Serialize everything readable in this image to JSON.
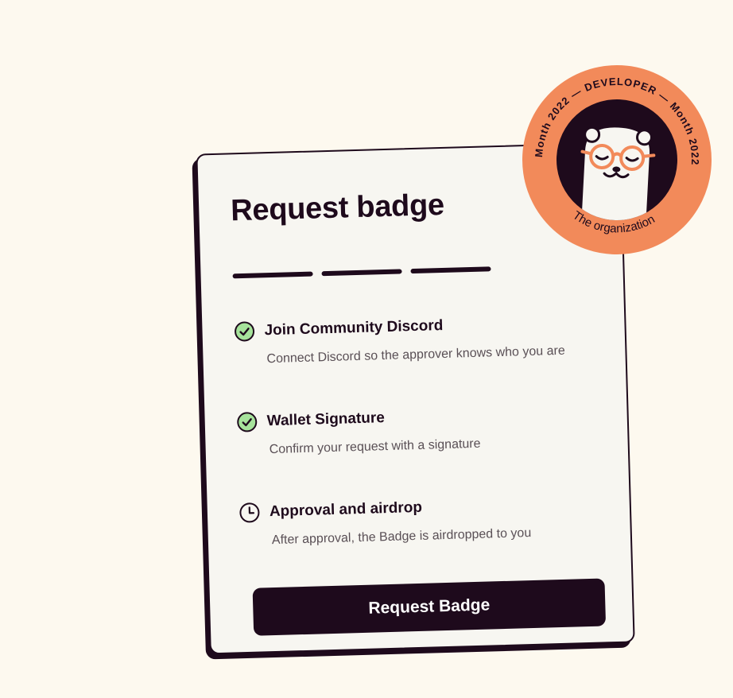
{
  "card": {
    "title": "Request badge",
    "progress": {
      "total_segments": 3
    },
    "steps": [
      {
        "title": "Join Community Discord",
        "description": "Connect Discord so the approver knows who you are",
        "status": "complete",
        "icon": "check-circle-icon"
      },
      {
        "title": "Wallet Signature",
        "description": "Confirm your request with a signature",
        "status": "complete",
        "icon": "check-circle-icon"
      },
      {
        "title": "Approval and airdrop",
        "description": "After approval, the Badge is airdropped to you",
        "status": "pending",
        "icon": "clock-icon"
      }
    ],
    "button_label": "Request Badge"
  },
  "badge": {
    "top_text": "Month 2022 — DEVELOPER — Month 2022",
    "role": "DEVELOPER",
    "period": "Month 2022",
    "separator": "—",
    "bottom_text": "The organization",
    "mascot": "otter-with-glasses",
    "colors": {
      "ring": "#f28a5a",
      "inner": "#1e0a1c",
      "glasses": "#f28a5a"
    }
  },
  "colors": {
    "background": "#fdf9ef",
    "card": "#f7f6f1",
    "ink": "#1e0a1c",
    "check_fill": "#a6e39b",
    "muted_text": "#5a5056"
  }
}
